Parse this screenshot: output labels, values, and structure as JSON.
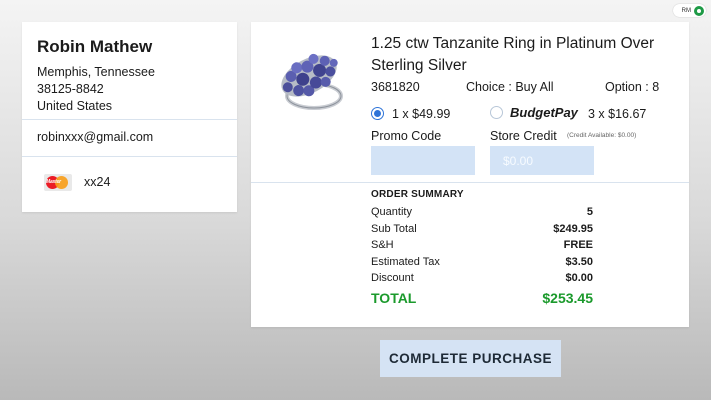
{
  "status": {
    "badge_text": "RM"
  },
  "customer": {
    "name": "Robin Mathew",
    "city_state": "Memphis, Tennessee",
    "zip": "38125-8842",
    "country": "United States",
    "email": "robinxxx@gmail.com",
    "card_suffix": "xx24",
    "card_brand_icon": "mastercard-icon"
  },
  "product": {
    "title": "1.25 ctw Tanzanite Ring in Platinum Over Sterling Silver",
    "sku": "3681820",
    "choice_label": "Choice : ",
    "choice_value": "Buy All",
    "option_text": "Option : 8",
    "image_icon": "ring-icon"
  },
  "payment": {
    "full_price_label": "1 x $49.99",
    "budget_pay_brand": "BudgetPay",
    "budget_pay_label": "3 x $16.67",
    "selected": "full"
  },
  "discounts": {
    "promo_label": "Promo Code",
    "promo_value": "",
    "store_credit_label": "Store Credit",
    "store_credit_note": "(Credit Available: $0.00)",
    "store_credit_placeholder": "$0.00"
  },
  "summary": {
    "title": "ORDER SUMMARY",
    "rows": [
      {
        "label": "Quantity",
        "value": "5"
      },
      {
        "label": "Sub Total",
        "value": "$249.95"
      },
      {
        "label": "S&H",
        "value": "FREE"
      },
      {
        "label": "Estimated Tax",
        "value": "$3.50"
      },
      {
        "label": "Discount",
        "value": "$0.00"
      }
    ],
    "total_label": "TOTAL",
    "total_value": "$253.45"
  },
  "actions": {
    "complete_purchase": "COMPLETE PURCHASE"
  },
  "colors": {
    "accent": "#2f74d8",
    "total_green": "#1b9a2c",
    "input_fill": "#d3e3f6"
  }
}
